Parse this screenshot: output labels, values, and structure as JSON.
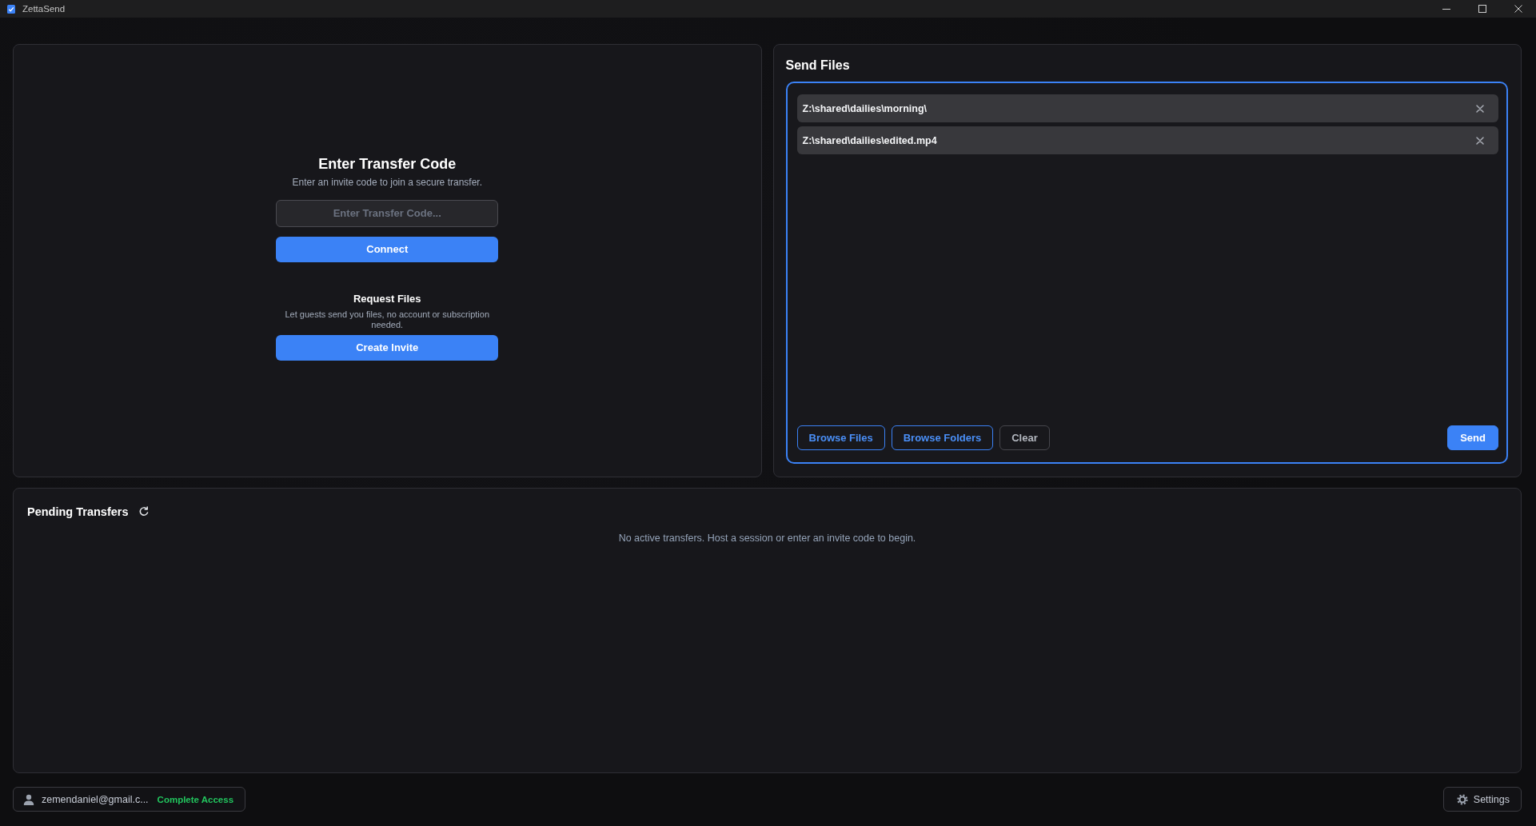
{
  "window": {
    "title": "ZettaSend"
  },
  "receive_panel": {
    "title": "Enter Transfer Code",
    "subtitle": "Enter an invite code to join a secure transfer.",
    "code_field": {
      "placeholder": "Enter Transfer Code..."
    },
    "connect_button": "Connect",
    "request": {
      "title": "Request Files",
      "description": "Let guests send you files, no account or subscription needed.",
      "button": "Create Invite"
    }
  },
  "send_panel": {
    "title": "Send Files",
    "files": [
      {
        "path": "Z:\\shared\\dailies\\morning\\"
      },
      {
        "path": "Z:\\shared\\dailies\\edited.mp4"
      }
    ],
    "buttons": [
      {
        "label": "Browse Files",
        "kind": "outline"
      },
      {
        "label": "Browse Folders",
        "kind": "outline"
      },
      {
        "label": "Clear",
        "kind": "neutral"
      },
      {
        "label": "Send",
        "kind": "primary"
      }
    ]
  },
  "pending_panel": {
    "title": "Pending Transfers",
    "empty_message": "No active transfers. Host a session or enter an invite code to begin."
  },
  "status_bar": {
    "account": {
      "email": "zemendaniel@gmail.c...",
      "plan": "Complete Access"
    },
    "settings_button": "Settings"
  }
}
